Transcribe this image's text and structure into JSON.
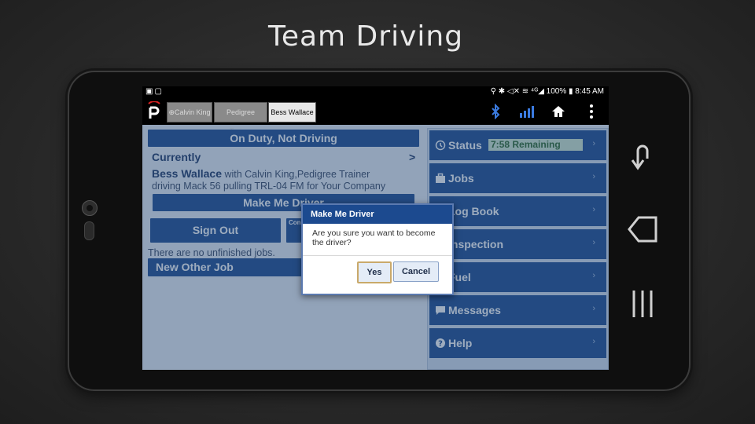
{
  "slide": {
    "title": "Team Driving"
  },
  "statusbar": {
    "left_icons": "▣▢",
    "right": "⚲ ✱ ◁✕ ≋ ⁴ᴳ◢ 100% ▮ 8:45 AM"
  },
  "tabs": [
    {
      "label": "⊕Calvin King",
      "active": false
    },
    {
      "label": "Pedigree Trainer",
      "active": false
    },
    {
      "label": "Bess Wallace",
      "active": true
    }
  ],
  "app_icons": [
    "bluetooth-icon",
    "signal-icon",
    "home-icon",
    "more-icon"
  ],
  "left": {
    "duty_status": "On Duty, Not Driving",
    "currently_label": "Currently",
    "currently_chevron": ">",
    "driver_name": "Bess Wallace",
    "driver_detail_1": " with Calvin King,Pedigree Trainer",
    "driver_detail_2": "driving Mack 56 pulling TRL-04 FM for Your Company",
    "make_driver_label": "Make Me Driver",
    "sign_out_label": "Sign Out",
    "second_button_label": "Con",
    "no_jobs_text": "There are no unfinished jobs.",
    "new_job_label": "New Other Job"
  },
  "right_menu": {
    "status_label": "Status",
    "status_remaining": "7:58 Remaining",
    "items": [
      {
        "label": "Jobs",
        "icon": "briefcase-icon"
      },
      {
        "label": "Log Book",
        "icon": "book-icon"
      },
      {
        "label": "Inspection",
        "icon": "clipboard-icon"
      },
      {
        "label": "Fuel",
        "icon": "fuel-icon"
      },
      {
        "label": "Messages",
        "icon": "message-icon"
      },
      {
        "label": "Help",
        "icon": "help-icon"
      }
    ],
    "chevron": "›"
  },
  "dialog": {
    "title": "Make Me Driver",
    "message": "Are you sure you want to become the driver?",
    "yes_label": "Yes",
    "cancel_label": "Cancel"
  },
  "colors": {
    "primary": "#1f4e92",
    "dialog_header": "#1c4a8f",
    "status_green": "#cfe7cf"
  }
}
